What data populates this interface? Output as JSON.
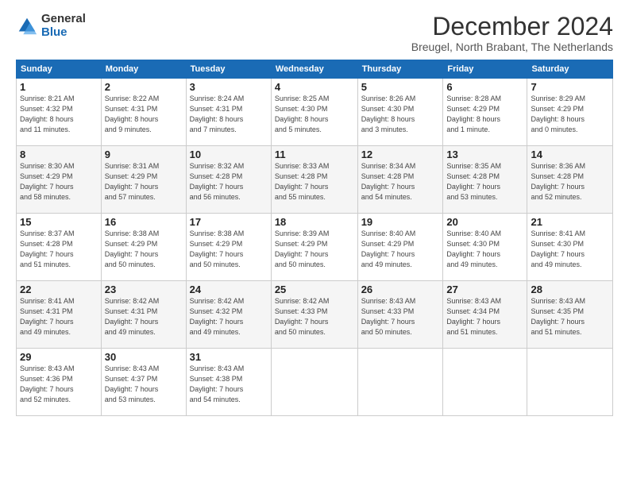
{
  "logo": {
    "general": "General",
    "blue": "Blue"
  },
  "title": "December 2024",
  "subtitle": "Breugel, North Brabant, The Netherlands",
  "headers": [
    "Sunday",
    "Monday",
    "Tuesday",
    "Wednesday",
    "Thursday",
    "Friday",
    "Saturday"
  ],
  "weeks": [
    [
      {
        "day": "1",
        "info": "Sunrise: 8:21 AM\nSunset: 4:32 PM\nDaylight: 8 hours\nand 11 minutes."
      },
      {
        "day": "2",
        "info": "Sunrise: 8:22 AM\nSunset: 4:31 PM\nDaylight: 8 hours\nand 9 minutes."
      },
      {
        "day": "3",
        "info": "Sunrise: 8:24 AM\nSunset: 4:31 PM\nDaylight: 8 hours\nand 7 minutes."
      },
      {
        "day": "4",
        "info": "Sunrise: 8:25 AM\nSunset: 4:30 PM\nDaylight: 8 hours\nand 5 minutes."
      },
      {
        "day": "5",
        "info": "Sunrise: 8:26 AM\nSunset: 4:30 PM\nDaylight: 8 hours\nand 3 minutes."
      },
      {
        "day": "6",
        "info": "Sunrise: 8:28 AM\nSunset: 4:29 PM\nDaylight: 8 hours\nand 1 minute."
      },
      {
        "day": "7",
        "info": "Sunrise: 8:29 AM\nSunset: 4:29 PM\nDaylight: 8 hours\nand 0 minutes."
      }
    ],
    [
      {
        "day": "8",
        "info": "Sunrise: 8:30 AM\nSunset: 4:29 PM\nDaylight: 7 hours\nand 58 minutes."
      },
      {
        "day": "9",
        "info": "Sunrise: 8:31 AM\nSunset: 4:29 PM\nDaylight: 7 hours\nand 57 minutes."
      },
      {
        "day": "10",
        "info": "Sunrise: 8:32 AM\nSunset: 4:28 PM\nDaylight: 7 hours\nand 56 minutes."
      },
      {
        "day": "11",
        "info": "Sunrise: 8:33 AM\nSunset: 4:28 PM\nDaylight: 7 hours\nand 55 minutes."
      },
      {
        "day": "12",
        "info": "Sunrise: 8:34 AM\nSunset: 4:28 PM\nDaylight: 7 hours\nand 54 minutes."
      },
      {
        "day": "13",
        "info": "Sunrise: 8:35 AM\nSunset: 4:28 PM\nDaylight: 7 hours\nand 53 minutes."
      },
      {
        "day": "14",
        "info": "Sunrise: 8:36 AM\nSunset: 4:28 PM\nDaylight: 7 hours\nand 52 minutes."
      }
    ],
    [
      {
        "day": "15",
        "info": "Sunrise: 8:37 AM\nSunset: 4:28 PM\nDaylight: 7 hours\nand 51 minutes."
      },
      {
        "day": "16",
        "info": "Sunrise: 8:38 AM\nSunset: 4:29 PM\nDaylight: 7 hours\nand 50 minutes."
      },
      {
        "day": "17",
        "info": "Sunrise: 8:38 AM\nSunset: 4:29 PM\nDaylight: 7 hours\nand 50 minutes."
      },
      {
        "day": "18",
        "info": "Sunrise: 8:39 AM\nSunset: 4:29 PM\nDaylight: 7 hours\nand 50 minutes."
      },
      {
        "day": "19",
        "info": "Sunrise: 8:40 AM\nSunset: 4:29 PM\nDaylight: 7 hours\nand 49 minutes."
      },
      {
        "day": "20",
        "info": "Sunrise: 8:40 AM\nSunset: 4:30 PM\nDaylight: 7 hours\nand 49 minutes."
      },
      {
        "day": "21",
        "info": "Sunrise: 8:41 AM\nSunset: 4:30 PM\nDaylight: 7 hours\nand 49 minutes."
      }
    ],
    [
      {
        "day": "22",
        "info": "Sunrise: 8:41 AM\nSunset: 4:31 PM\nDaylight: 7 hours\nand 49 minutes."
      },
      {
        "day": "23",
        "info": "Sunrise: 8:42 AM\nSunset: 4:31 PM\nDaylight: 7 hours\nand 49 minutes."
      },
      {
        "day": "24",
        "info": "Sunrise: 8:42 AM\nSunset: 4:32 PM\nDaylight: 7 hours\nand 49 minutes."
      },
      {
        "day": "25",
        "info": "Sunrise: 8:42 AM\nSunset: 4:33 PM\nDaylight: 7 hours\nand 50 minutes."
      },
      {
        "day": "26",
        "info": "Sunrise: 8:43 AM\nSunset: 4:33 PM\nDaylight: 7 hours\nand 50 minutes."
      },
      {
        "day": "27",
        "info": "Sunrise: 8:43 AM\nSunset: 4:34 PM\nDaylight: 7 hours\nand 51 minutes."
      },
      {
        "day": "28",
        "info": "Sunrise: 8:43 AM\nSunset: 4:35 PM\nDaylight: 7 hours\nand 51 minutes."
      }
    ],
    [
      {
        "day": "29",
        "info": "Sunrise: 8:43 AM\nSunset: 4:36 PM\nDaylight: 7 hours\nand 52 minutes."
      },
      {
        "day": "30",
        "info": "Sunrise: 8:43 AM\nSunset: 4:37 PM\nDaylight: 7 hours\nand 53 minutes."
      },
      {
        "day": "31",
        "info": "Sunrise: 8:43 AM\nSunset: 4:38 PM\nDaylight: 7 hours\nand 54 minutes."
      },
      {
        "day": "",
        "info": ""
      },
      {
        "day": "",
        "info": ""
      },
      {
        "day": "",
        "info": ""
      },
      {
        "day": "",
        "info": ""
      }
    ]
  ]
}
